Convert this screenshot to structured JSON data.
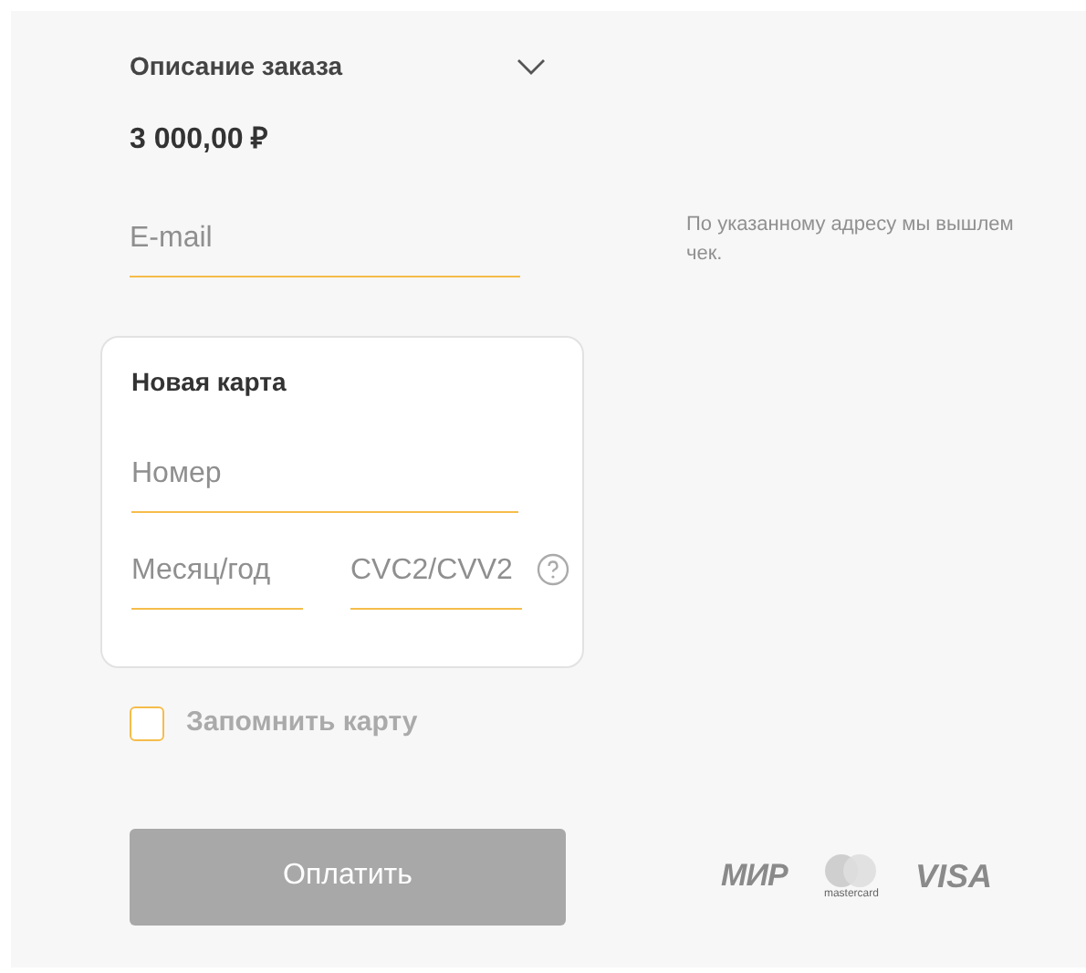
{
  "order": {
    "title": "Описание заказа",
    "expanded": false,
    "amount": "3 000,00 ₽"
  },
  "email": {
    "placeholder": "E-mail",
    "hint": "По указанному адресу мы вышлем чек."
  },
  "card": {
    "title": "Новая карта",
    "number_placeholder": "Номер",
    "expiry_placeholder": "Месяц/год",
    "cvc_placeholder": "CVC2/CVV2"
  },
  "remember": {
    "label": "Запомнить карту",
    "checked": false
  },
  "pay_button": {
    "label": "Оплатить",
    "disabled": true
  },
  "logos": [
    {
      "kind": "mir",
      "text": "МИР"
    },
    {
      "kind": "mastercard",
      "text": "mastercard"
    },
    {
      "kind": "visa",
      "text": "VISA"
    }
  ]
}
